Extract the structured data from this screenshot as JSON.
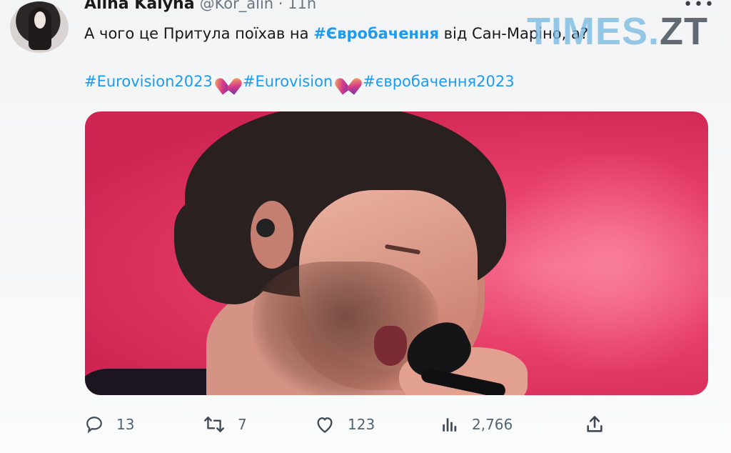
{
  "author": {
    "name": "Alina Kalyna",
    "handle": "@Kor_alin · 11h"
  },
  "tweet": {
    "text_before": "А чого це Притула поїхав на ",
    "hashtag_bold": "#Євробачення",
    "text_after": " від Сан-Маріно, а?",
    "hashtags": [
      "#Eurovision2023",
      "#Eurovision",
      "#євробачення2023"
    ]
  },
  "watermark": {
    "times": "TIMES.",
    "zt": "ZT"
  },
  "actions": {
    "reply_count": "13",
    "retweet_count": "7",
    "like_count": "123",
    "views_count": "2,766"
  },
  "icons": {
    "avatar": "avatar",
    "more": "more-icon",
    "reply": "reply-icon",
    "retweet": "retweet-icon",
    "like": "heart-icon",
    "views": "views-icon",
    "share": "share-icon",
    "eurovision_heart": "eurovision-heart-icon"
  },
  "colors": {
    "hashtag": "#1d9bf0",
    "muted": "#536471",
    "stage_pink": "#e8406a"
  }
}
